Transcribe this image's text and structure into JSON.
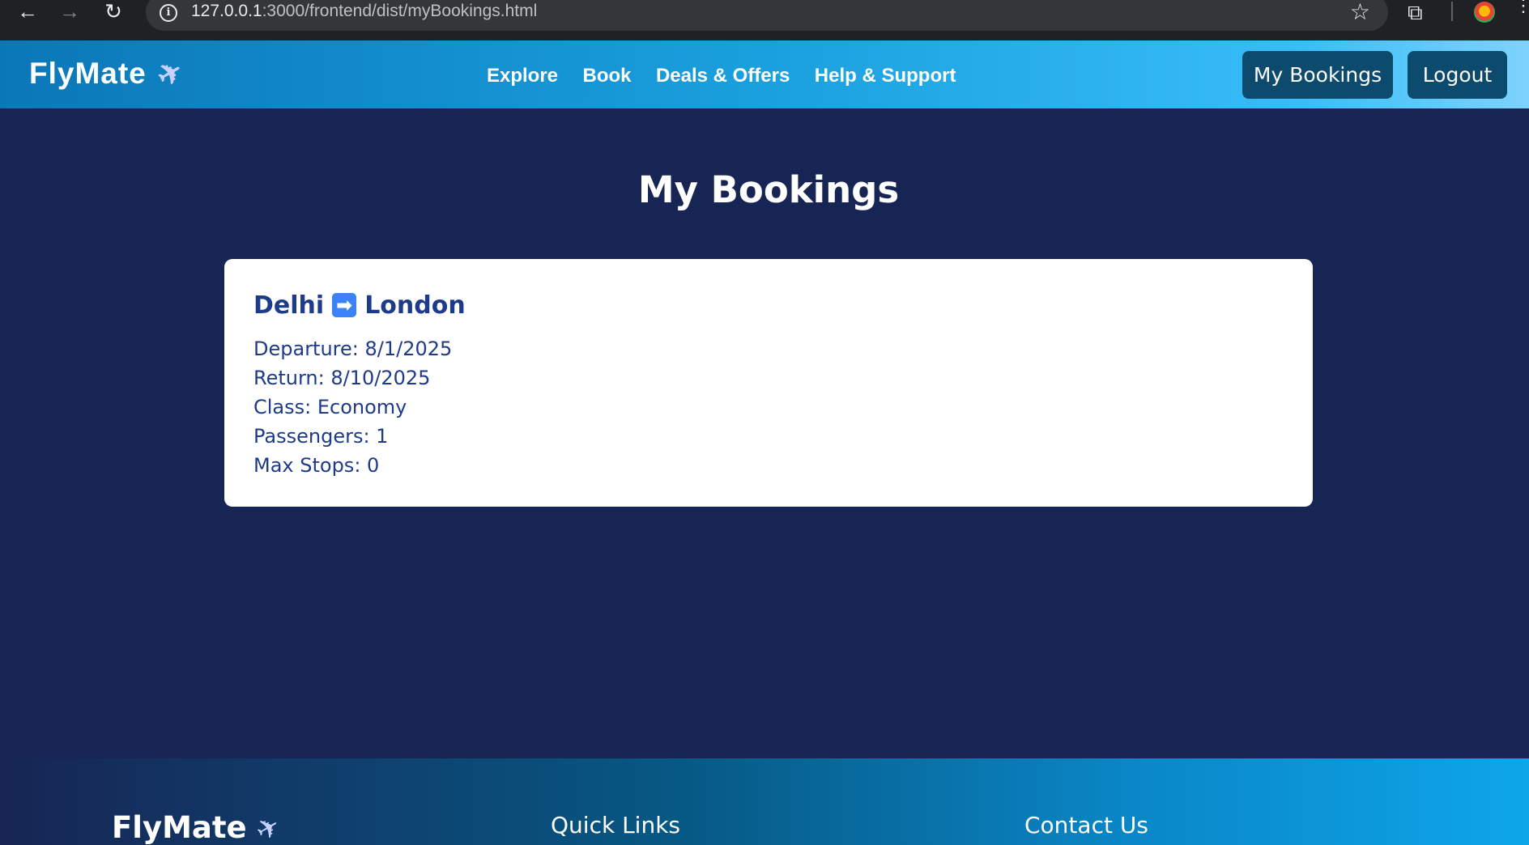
{
  "browser": {
    "url_host": "127.0.0.1",
    "url_path": ":3000/frontend/dist/myBookings.html",
    "back_icon": "arrow-left-icon",
    "forward_icon": "arrow-right-icon",
    "reload_icon": "reload-icon",
    "bookmark_icon": "star-icon",
    "extensions_icon": "puzzle-icon",
    "menu_icon": "kebab-menu-icon"
  },
  "header": {
    "brand": "FlyMate",
    "nav": [
      "Explore",
      "Book",
      "Deals & Offers",
      "Help & Support"
    ],
    "my_bookings_label": "My Bookings",
    "logout_label": "Logout",
    "accent_color": "#0c4a6e"
  },
  "main": {
    "title": "My Bookings",
    "bookings": [
      {
        "from": "Delhi",
        "to": "London",
        "departure": "Departure: 8/1/2025",
        "return": "Return: 8/10/2025",
        "class": "Class: Economy",
        "passengers": "Passengers: 1",
        "max_stops": "Max Stops: 0"
      }
    ]
  },
  "footer": {
    "brand": "FlyMate",
    "quick_links_title": "Quick Links",
    "contact_title": "Contact Us"
  }
}
